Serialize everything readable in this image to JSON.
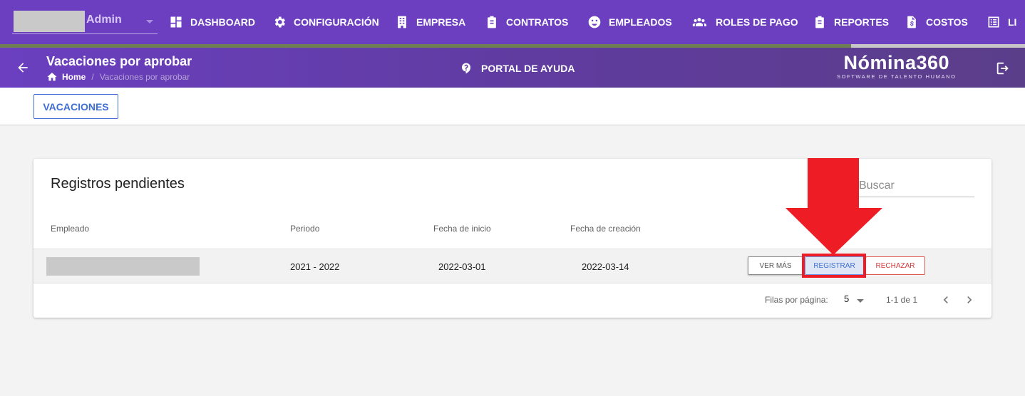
{
  "colors": {
    "topbar": "#6c3fc1",
    "accent_blue": "#3f6fd4",
    "reject_red": "#d23b3b",
    "annotation_red": "#ee1c25"
  },
  "top_nav": {
    "user_label": "Admin",
    "items": [
      {
        "label": "DASHBOARD",
        "icon": "dashboard-icon"
      },
      {
        "label": "CONFIGURACIÓN",
        "icon": "gear-icon"
      },
      {
        "label": "EMPRESA",
        "icon": "building-icon"
      },
      {
        "label": "CONTRATOS",
        "icon": "clipboard-icon"
      },
      {
        "label": "EMPLEADOS",
        "icon": "face-icon"
      },
      {
        "label": "ROLES DE PAGO",
        "icon": "group-icon"
      },
      {
        "label": "REPORTES",
        "icon": "clipboard-icon"
      },
      {
        "label": "COSTOS",
        "icon": "money-file-icon"
      },
      {
        "label": "LI",
        "icon": "list-icon"
      }
    ]
  },
  "loading_progress": 0.83,
  "header": {
    "title": "Vacaciones por aprobar",
    "breadcrumb": {
      "home": "Home",
      "separator": "/",
      "current": "Vacaciones por aprobar"
    },
    "help_label": "PORTAL DE AYUDA",
    "brand_name": "Nómina360",
    "brand_tagline": "SOFTWARE DE TALENTO HUMANO"
  },
  "tabs": {
    "vacaciones": "VACACIONES"
  },
  "card": {
    "title": "Registros pendientes",
    "search_placeholder": "Buscar",
    "columns": {
      "empleado": "Empleado",
      "periodo": "Periodo",
      "fecha_inicio": "Fecha de inicio",
      "fecha_creacion": "Fecha de creación"
    },
    "rows": [
      {
        "periodo": "2021 - 2022",
        "fecha_inicio": "2022-03-01",
        "fecha_creacion": "2022-03-14"
      }
    ],
    "actions": {
      "ver_mas": "VER MÁS",
      "registrar": "REGISTRAR",
      "rechazar": "RECHAZAR"
    },
    "pagination": {
      "rows_per_page_label": "Filas por página:",
      "rows_per_page": "5",
      "range": "1-1 de 1"
    }
  }
}
